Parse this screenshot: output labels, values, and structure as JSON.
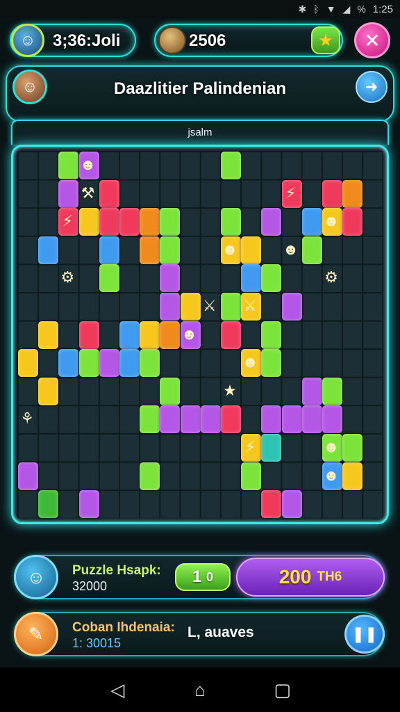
{
  "status_bar": {
    "time": "1:25",
    "battery": "%",
    "icons": [
      "bluetooth-icon",
      "vibrate-icon",
      "wifi-icon",
      "signal-icon"
    ]
  },
  "hud": {
    "player_name": "3;36:Joli",
    "coins": "2506"
  },
  "title": {
    "text": "Daazlitier Palindenian"
  },
  "board": {
    "label": "jsalm",
    "tile_colors": [
      "#7be33a",
      "#3f9bf0",
      "#ef3a5c",
      "#f6c81e",
      "#b456e6",
      "#f18a1c",
      "#2cc4b4",
      "#3fb83a"
    ]
  },
  "panel_puzzle": {
    "label": "Puzzle Hsapk:",
    "sub": "32000",
    "level": "1",
    "level_suffix": "0",
    "score": "200",
    "score_unit": "TH6"
  },
  "panel_moves": {
    "label": "Coban Ihdenaia:",
    "sub": "1: 30015",
    "moves_text": "L, auaves"
  },
  "nav": {
    "back": "◁",
    "home": "⌂",
    "recents": "▢"
  }
}
